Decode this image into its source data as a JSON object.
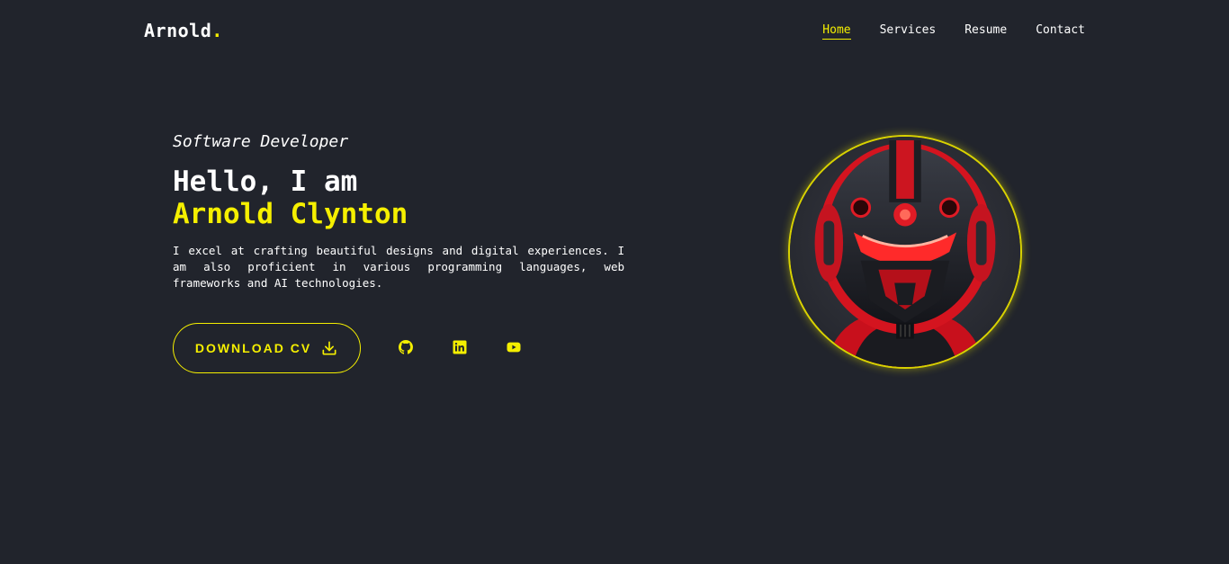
{
  "brand": {
    "name": "Arnold",
    "dot": "."
  },
  "nav": {
    "items": [
      {
        "label": "Home",
        "active": true
      },
      {
        "label": "Services",
        "active": false
      },
      {
        "label": "Resume",
        "active": false
      },
      {
        "label": "Contact",
        "active": false
      }
    ]
  },
  "hero": {
    "subtitle": "Software Developer",
    "greeting": "Hello, I am",
    "name": "Arnold Clynton",
    "bio": "I excel at crafting beautiful designs and digital experiences. I am also proficient in various programming languages, web frameworks and AI technologies.",
    "cv_button": "DOWNLOAD CV",
    "socials": [
      {
        "icon": "github-icon"
      },
      {
        "icon": "linkedin-icon"
      },
      {
        "icon": "youtube-icon"
      }
    ]
  },
  "colors": {
    "background": "#21242c",
    "accent": "#f5ef00",
    "text": "#ffffff"
  }
}
